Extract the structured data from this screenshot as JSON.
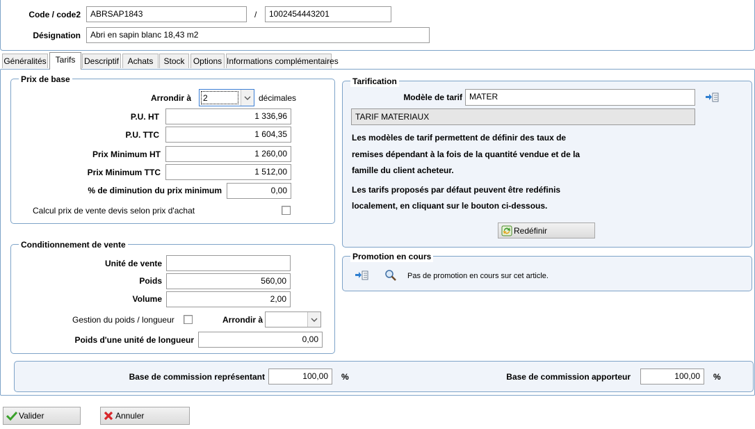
{
  "header": {
    "code_label": "Code / code2",
    "code_value": "ABRSAP1843",
    "separator": "/",
    "code2_value": "1002454443201",
    "designation_label": "Désignation",
    "designation_value": "Abri en sapin blanc 18,43 m2"
  },
  "tabs": [
    {
      "label": "Généralités"
    },
    {
      "label": "Tarifs",
      "active": true
    },
    {
      "label": "Descriptif"
    },
    {
      "label": "Achats"
    },
    {
      "label": "Stock"
    },
    {
      "label": "Options"
    },
    {
      "label": "Informations complémentaires"
    }
  ],
  "prix_base": {
    "title": "Prix de base",
    "arrondir_label": "Arrondir à",
    "arrondir_value": "2",
    "decimales_label": "décimales",
    "pu_ht_label": "P.U. HT",
    "pu_ht_value": "1 336,96",
    "pu_ttc_label": "P.U. TTC",
    "pu_ttc_value": "1 604,35",
    "prix_min_ht_label": "Prix Minimum HT",
    "prix_min_ht_value": "1 260,00",
    "prix_min_ttc_label": "Prix Minimum TTC",
    "prix_min_ttc_value": "1 512,00",
    "diminution_label": "% de diminution du prix minimum",
    "diminution_value": "0,00",
    "calcul_label": "Calcul prix de vente devis selon prix d'achat"
  },
  "conditionnement": {
    "title": "Conditionnement de vente",
    "unite_label": "Unité de vente",
    "unite_value": "",
    "poids_label": "Poids",
    "poids_value": "560,00",
    "volume_label": "Volume",
    "volume_value": "2,00",
    "gestion_label": "Gestion du poids / longueur",
    "arrondir_label": "Arrondir à",
    "arrondir_value": "",
    "poids_unite_label": "Poids d'une unité de longueur",
    "poids_unite_value": "0,00"
  },
  "tarification": {
    "title": "Tarification",
    "modele_label": "Modèle de tarif",
    "modele_value": "MATER",
    "modele_desc": "TARIF MATERIAUX",
    "text_line1": "Les modèles de tarif permettent de définir des taux de",
    "text_line2": "remises dépendant à la fois de la quantité vendue et de la",
    "text_line3": "famille du client acheteur.",
    "text_line4": "Les tarifs proposés par défaut peuvent être redéfinis",
    "text_line5": "localement, en cliquant sur le bouton ci-dessous.",
    "redefinir_label": "Redéfinir"
  },
  "promotion": {
    "title": "Promotion en cours",
    "message": "Pas de promotion en cours sur cet article."
  },
  "commission": {
    "representant_label": "Base de commission représentant",
    "representant_value": "100,00",
    "apporteur_label": "Base de commission apporteur",
    "apporteur_value": "100,00",
    "percent": "%"
  },
  "footer": {
    "valider_label": "Valider",
    "annuler_label": "Annuler"
  },
  "icons": [
    "list-arrow-icon",
    "magnifier-icon",
    "recycle-icon",
    "checkmark-icon",
    "red-x-icon",
    "chevron-down-icon"
  ],
  "colors": {
    "accent_border": "#7ea3c8",
    "panel_bg": "#f0f4fa"
  }
}
